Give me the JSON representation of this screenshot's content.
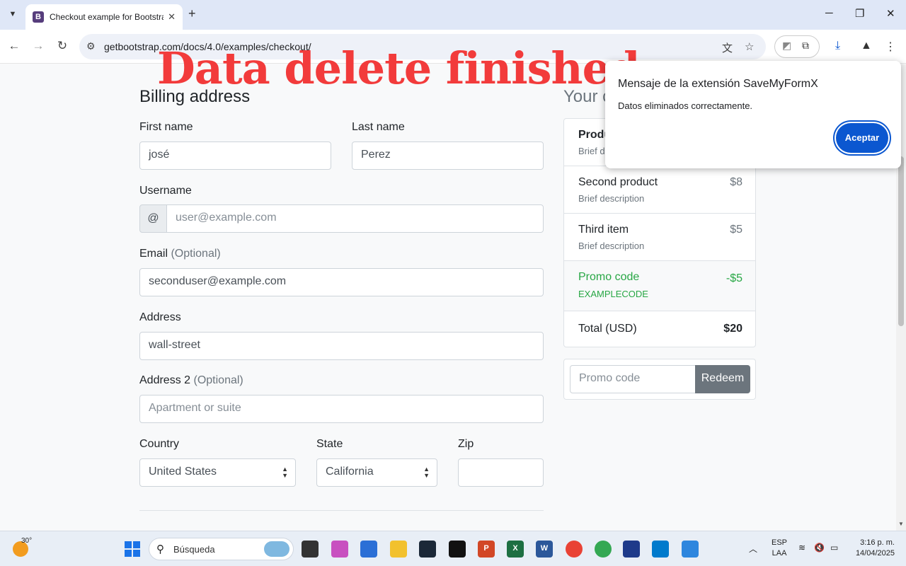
{
  "browser": {
    "tab_title": "Checkout example for Bootstrap",
    "tab_favicon": "B",
    "url": "getbootstrap.com/docs/4.0/examples/checkout/",
    "new_tab": "+",
    "minimize": "─",
    "restore": "❐",
    "close": "✕"
  },
  "overlay_text": "Data delete finished",
  "form": {
    "heading": "Billing address",
    "first_name_label": "First name",
    "first_name_value": "josé",
    "last_name_label": "Last name",
    "last_name_value": "Perez",
    "username_label": "Username",
    "username_prefix": "@",
    "username_placeholder": "user@example.com",
    "email_label": "Email",
    "email_optional": "(Optional)",
    "email_value": "seconduser@example.com",
    "address_label": "Address",
    "address_value": "wall-street",
    "address2_label": "Address 2",
    "address2_optional": "(Optional)",
    "address2_placeholder": "Apartment or suite",
    "country_label": "Country",
    "country_value": "United States",
    "state_label": "State",
    "state_value": "California",
    "zip_label": "Zip",
    "zip_value": ""
  },
  "cart": {
    "title_partial": "Your c",
    "items": [
      {
        "name": "Produ",
        "desc": "Brief de",
        "price": ""
      },
      {
        "name": "Second product",
        "desc": "Brief description",
        "price": "$8"
      },
      {
        "name": "Third item",
        "desc": "Brief description",
        "price": "$5"
      }
    ],
    "promo": {
      "name": "Promo code",
      "code": "EXAMPLECODE",
      "price": "-$5"
    },
    "total_label": "Total (USD)",
    "total_value": "$20",
    "promo_placeholder": "Promo code",
    "redeem_label": "Redeem"
  },
  "dialog": {
    "title": "Mensaje de la extensión SaveMyFormX",
    "message": "Datos eliminados correctamente.",
    "button": "Aceptar"
  },
  "taskbar": {
    "weather_temp": "30°",
    "search_placeholder": "Búsqueda",
    "lang_line1": "ESP",
    "lang_line2": "LAA",
    "time": "3:16 p. m.",
    "date": "14/04/2025"
  },
  "colors": {
    "accent": "#0b57d0",
    "overlay": "#f23b3b",
    "promo_green": "#28a745"
  }
}
